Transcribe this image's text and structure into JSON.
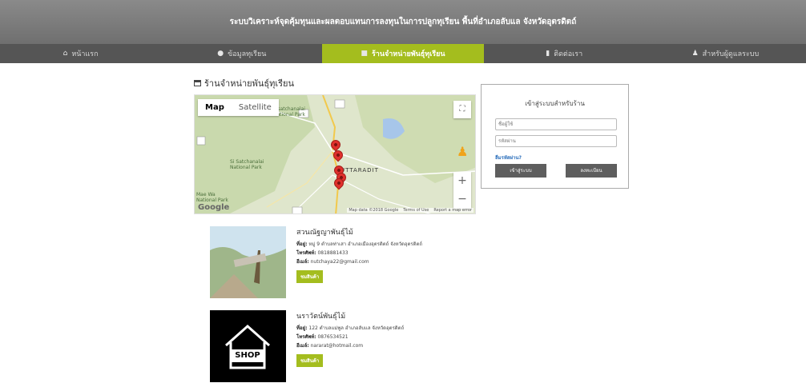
{
  "header": {
    "title": "ระบบวิเคราะห์จุดคุ้มทุนและผลตอบแทนการลงทุนในการปลูกทุเรียน พื้นที่อำเภอลับแล จังหวัดอุตรดิตถ์"
  },
  "nav": [
    {
      "label": "หน้าแรก",
      "icon": "home-icon"
    },
    {
      "label": "ข้อมูลทุเรียน",
      "icon": "durian-icon"
    },
    {
      "label": "ร้านจำหน่ายพันธุ์ทุเรียน",
      "icon": "store-icon"
    },
    {
      "label": "ติดต่อเรา",
      "icon": "chat-icon"
    },
    {
      "label": "สำหรับผู้ดูแลระบบ",
      "icon": "admin-icon"
    }
  ],
  "page": {
    "heading": "ร้านจำหน่ายพันธุ์ทุเรียน"
  },
  "map": {
    "tab_map": "Map",
    "tab_satellite": "Satellite",
    "google": "Google",
    "credit_data": "Map data ©2018 Google",
    "credit_terms": "Terms of Use",
    "credit_report": "Report a map error",
    "labels": {
      "park_top": "Sisatchanalai National Park",
      "park_left": "Si Satchanalai National Park",
      "park_bottom": "Mae Wa National Park",
      "town": "UTTARADIT"
    }
  },
  "login": {
    "title": "เข้าสู่ระบบสำหรับร้าน",
    "username_placeholder": "ชื่อผู้ใช้",
    "password_placeholder": "รหัสผ่าน",
    "forgot": "ลืมรหัสผ่าน?",
    "login_button": "เข้าสู่ระบบ",
    "register_button": "ลงทะเบียน"
  },
  "stores": [
    {
      "name": "สวนณัฐญาพันธุ์ไม้",
      "address_label": "ที่อยู่:",
      "address": "หมู่ 9 ตำบลท่าเสา อำเภอเมืองอุตรดิตถ์ จังหวัดอุตรดิตถ์",
      "phone_label": "โทรศัพท์:",
      "phone": "0818881433",
      "email_label": "อีเมล์:",
      "email": "nutchaya22@gmail.com",
      "button": "ชมสินค้า"
    },
    {
      "name": "นราวัตน์พันธุ์ไม้",
      "address_label": "ที่อยู่:",
      "address": "122 ตำบลแม่พูล อำเภอลับแล จังหวัดอุตรดิตถ์",
      "phone_label": "โทรศัพท์:",
      "phone": "0876534521",
      "email_label": "อีเมล์:",
      "email": "nararat@hotmail.com",
      "button": "ชมสินค้า",
      "image_text": "SHOP"
    }
  ]
}
